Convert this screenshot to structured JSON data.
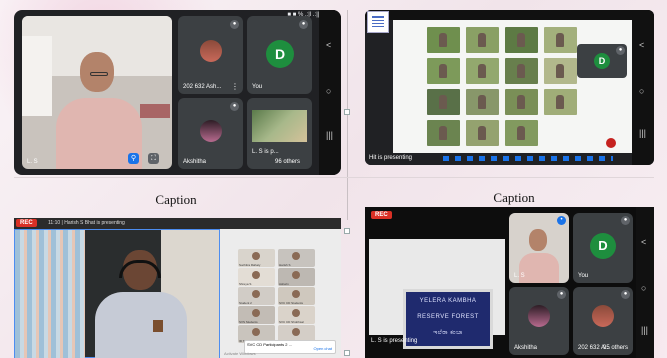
{
  "captions": [
    "Caption",
    "Caption"
  ],
  "colors": {
    "meet_bg": "#202124",
    "tile_bg": "#3c4043",
    "avatar_green": "#1e8e3e",
    "rec_red": "#d93025",
    "accent_blue": "#1a73e8"
  },
  "screenshot1": {
    "status": "■ ■ % .:|l .:|| 52%",
    "tiles": [
      {
        "label": "202 632 Ash..."
      },
      {
        "label": "You",
        "initial": "D"
      },
      {
        "label": "Akshitha"
      },
      {
        "label": "L. S is p...",
        "badge": "96 others"
      }
    ],
    "main_label": "L. S",
    "icons": [
      "pin-icon",
      "fullscreen-icon",
      "mic-off-icon",
      "more-vert-icon"
    ]
  },
  "screenshot2": {
    "presenting_label": "Hit is presenting",
    "self_initial": "D",
    "photo_count": 15
  },
  "screenshot3": {
    "rec": "REC",
    "header": "11:10 | Harish S Bhat is presenting",
    "participants": [
      {
        "label": "Suchitra Rahaty"
      },
      {
        "label": "Harish S"
      },
      {
        "label": "Shreya S"
      },
      {
        "label": "Ashwin"
      },
      {
        "label": "Student 2"
      },
      {
        "label": "SVC CD Students"
      },
      {
        "label": "SVS Students"
      },
      {
        "label": "SVC CD Shobhsal"
      },
      {
        "label": "ID Team Fellow"
      },
      {
        "label": "SVC 11 Prasad"
      }
    ],
    "toast": "SVC CD Participants 2 ...",
    "toast_action": "Open chat",
    "bottom_label": "Activate Windows"
  },
  "screenshot4": {
    "rec": "REC",
    "sign_lines": [
      "YELERA KAMBHA",
      "RESERVE FOREST",
      "ಇಲೆರಾ ಕಂಬಾ"
    ],
    "presenting_label": "L. S is presenting",
    "tiles": [
      {
        "label": "L. S"
      },
      {
        "label": "You",
        "initial": "D"
      },
      {
        "label": "Akshitha"
      },
      {
        "label": "202 632 A...",
        "badge": "95 others"
      }
    ]
  }
}
